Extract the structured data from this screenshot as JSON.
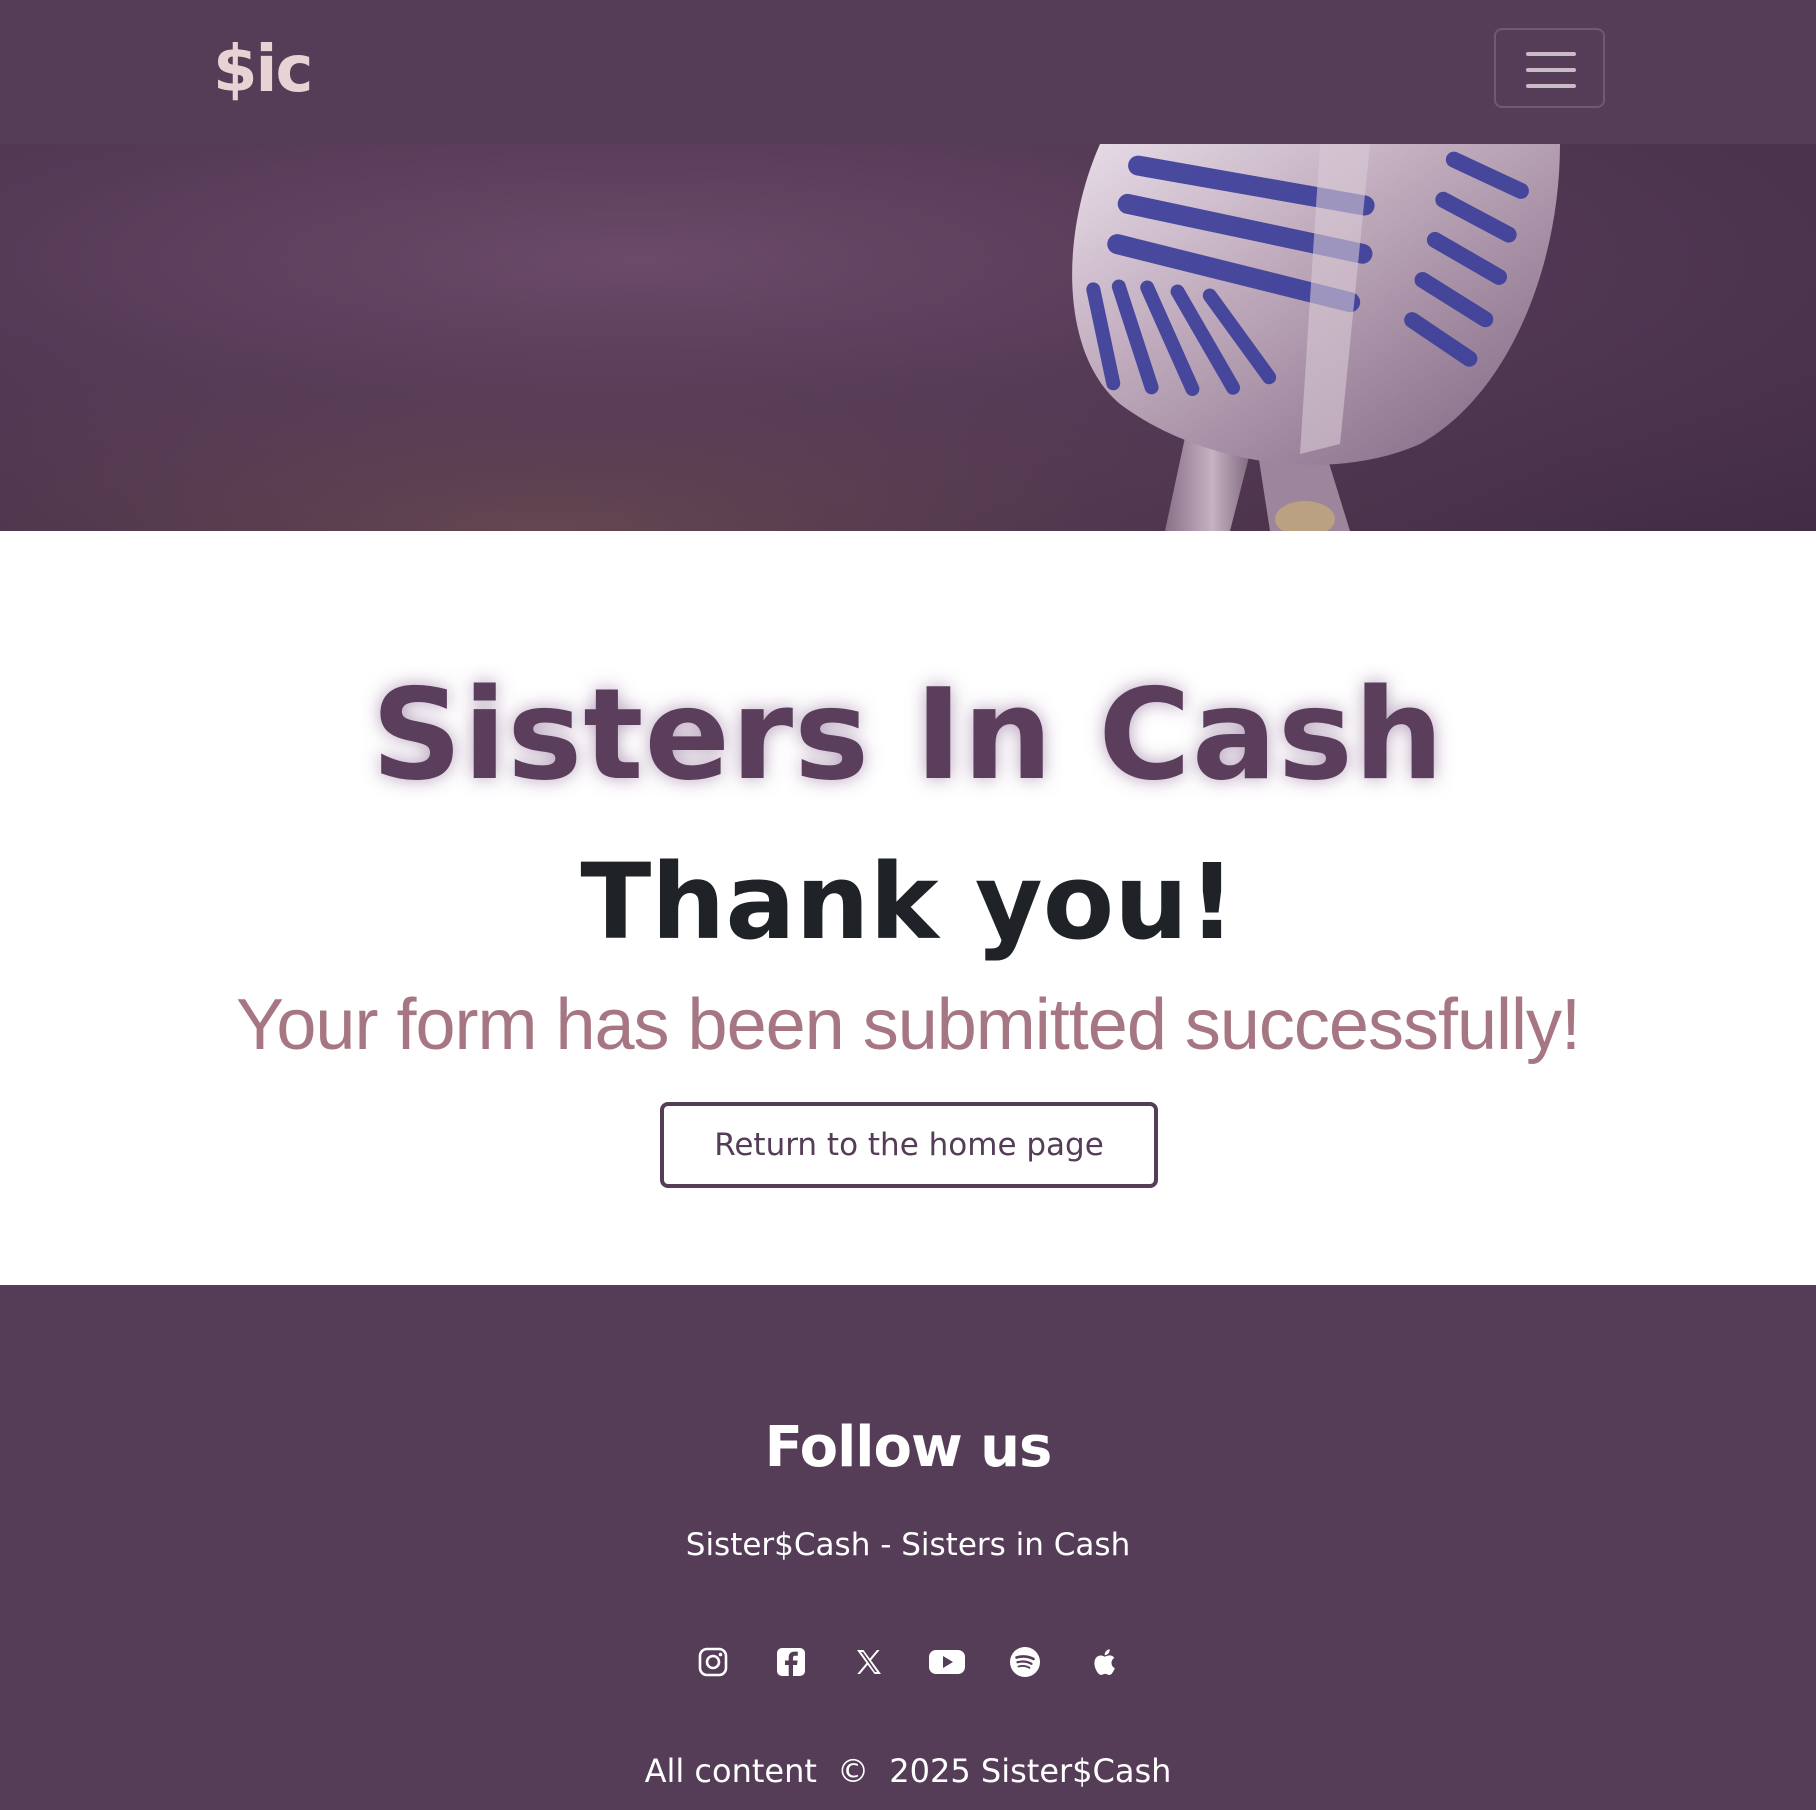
{
  "navbar": {
    "brand": "$ic",
    "toggler_icon": "hamburger-menu-icon"
  },
  "hero": {
    "image": "microphone-photo"
  },
  "main": {
    "title": "Sisters In Cash",
    "heading": "Thank you!",
    "message": "Your form has been submitted successfully!",
    "button_label": "Return to the home page"
  },
  "footer": {
    "title": "Follow us",
    "subtitle": "Sister$Cash - Sisters in Cash",
    "socials": [
      {
        "name": "instagram-icon"
      },
      {
        "name": "facebook-icon"
      },
      {
        "name": "x-twitter-icon"
      },
      {
        "name": "youtube-icon"
      },
      {
        "name": "spotify-icon"
      },
      {
        "name": "apple-icon"
      }
    ],
    "copyright_prefix": "All content",
    "copyright_symbol": "©",
    "copyright_suffix": "2025 Sister$Cash"
  },
  "colors": {
    "primary": "#553d58",
    "brand_text": "#e8d2d4",
    "message": "#a67783",
    "heading": "#1f2226"
  }
}
